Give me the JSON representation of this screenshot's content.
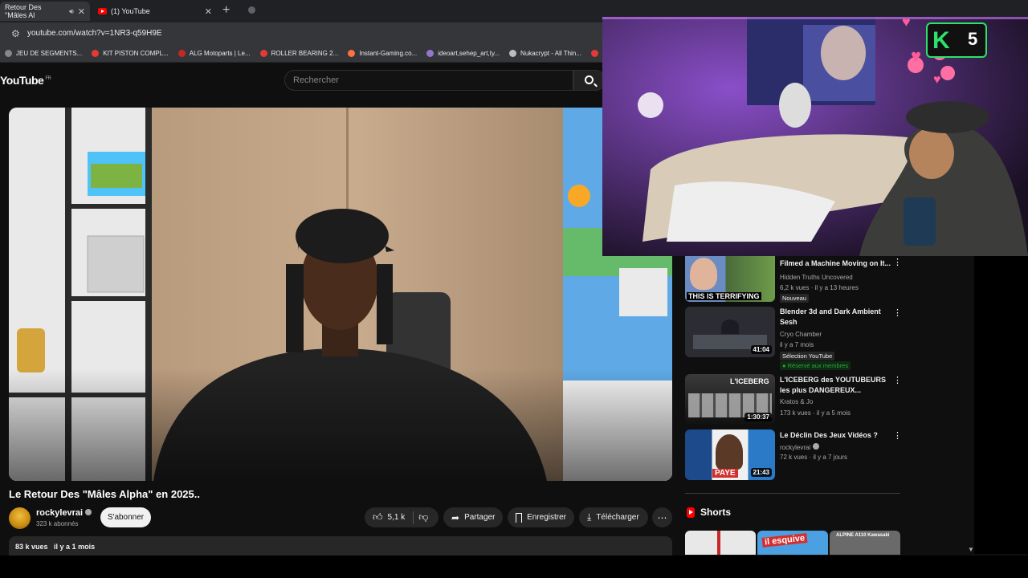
{
  "browser": {
    "tabs": [
      {
        "title": "Retour Des \"Mâles Al",
        "active": true,
        "close": "✕"
      },
      {
        "title": "(1) YouTube",
        "active": false,
        "close": "✕"
      }
    ],
    "new_tab": "+",
    "url": "youtube.com/watch?v=1NR3-q59H9E",
    "bookmarks": [
      {
        "label": "JEU DE SEGMENTS...",
        "color": "#888888"
      },
      {
        "label": "KIT PISTON COMPL...",
        "color": "#e53935"
      },
      {
        "label": "ALG Motoparts | Le...",
        "color": "#c62828"
      },
      {
        "label": "ROLLER BEARING 2...",
        "color": "#e53935"
      },
      {
        "label": "Instant-Gaming.co...",
        "color": "#ff7043"
      },
      {
        "label": "ideoart,sehep_art,ty...",
        "color": "#9575cd"
      },
      {
        "label": "Nukacrypt - All Thin...",
        "color": "#bdbdbd"
      },
      {
        "label": "D",
        "color": "#e53935"
      }
    ]
  },
  "youtube": {
    "logo": "YouTube",
    "region": "FR",
    "search_placeholder": "Rechercher"
  },
  "video": {
    "title": "Le Retour Des \"Mâles Alpha\" en 2025..",
    "channel": "rockylevrai",
    "subscribers": "323 k abonnés",
    "subscribe_label": "S'abonner",
    "likes": "5,1 k",
    "share_label": "Partager",
    "save_label": "Enregistrer",
    "download_label": "Télécharger",
    "views": "83 k vues",
    "date": "il y a 1 mois"
  },
  "recommendations": [
    {
      "title": "Filmed a Machine Moving on It...",
      "channel": "Hidden Truths Uncovered",
      "meta": "6,2 k vues · il y a 13 heures",
      "badge": "Nouveau",
      "thumb_text": "THIS IS TERRIFYING",
      "duration": ""
    },
    {
      "title": "Blender 3d and Dark Ambient Sesh",
      "channel": "Cryo Chamber",
      "meta": "il y a 7 mois",
      "badge": "Sélection YouTube",
      "members": "Réservé aux membres",
      "duration": "41:04"
    },
    {
      "title": "L'ICEBERG des YOUTUBEURS les plus DANGEREUX...",
      "channel": "Kratos & Jo",
      "meta": "173 k vues · il y a 5 mois",
      "duration": "1:30:37",
      "thumb_text": "L'ICEBERG"
    },
    {
      "title": "Le Déclin Des Jeux Vidéos ?",
      "channel": "rockylevrai",
      "meta": "72 k vues · il y a 7 jours",
      "duration": "21:43",
      "thumb_text": "PAYE"
    }
  ],
  "shorts": {
    "heading": "Shorts",
    "items": [
      {
        "label": ""
      },
      {
        "label": "il esquive"
      },
      {
        "label": "ALPINE A110 Kawasaki"
      }
    ]
  },
  "overlay": {
    "stream_badge": "5"
  },
  "colors": {
    "yt_red": "#ff0000",
    "bg": "#0f0f0f",
    "pill": "#272727",
    "members_green": "#2ba640"
  }
}
